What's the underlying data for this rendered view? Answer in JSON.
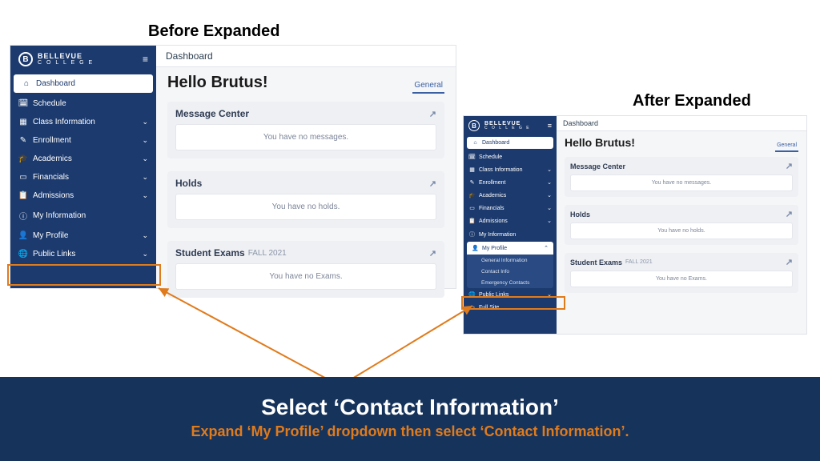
{
  "labels": {
    "before": "Before Expanded",
    "after": "After Expanded"
  },
  "brand": {
    "name": "BELLEVUE",
    "sub": "C O L L E G E",
    "logo_letter": "B"
  },
  "sidebar": {
    "items": [
      {
        "icon": "⌂",
        "label": "Dashboard"
      },
      {
        "icon": "🗓",
        "label": "Schedule"
      },
      {
        "icon": "▦",
        "label": "Class Information"
      },
      {
        "icon": "✎",
        "label": "Enrollment"
      },
      {
        "icon": "🎓",
        "label": "Academics"
      },
      {
        "icon": "▭",
        "label": "Financials"
      },
      {
        "icon": "📋",
        "label": "Admissions"
      },
      {
        "icon": "ⓘ",
        "label": "My Information"
      },
      {
        "icon": "👤",
        "label": "My Profile"
      },
      {
        "icon": "🌐",
        "label": "Public Links"
      },
      {
        "icon": "▭",
        "label": "Full Site"
      }
    ],
    "my_profile_sub": [
      "General Information",
      "Contact Info",
      "Emergency Contacts"
    ]
  },
  "content": {
    "topbar": "Dashboard",
    "hello": "Hello Brutus!",
    "tab_general": "General",
    "cards": {
      "messages": {
        "title": "Message Center",
        "body": "You have no messages."
      },
      "holds": {
        "title": "Holds",
        "body": "You have no holds."
      },
      "exams": {
        "title": "Student Exams",
        "term": "FALL 2021",
        "body": "You have no Exams."
      }
    },
    "external_icon": "↗"
  },
  "banner": {
    "title": "Select ‘Contact Information’",
    "subtitle": "Expand ‘My Profile’ dropdown then select ‘Contact Information’."
  }
}
